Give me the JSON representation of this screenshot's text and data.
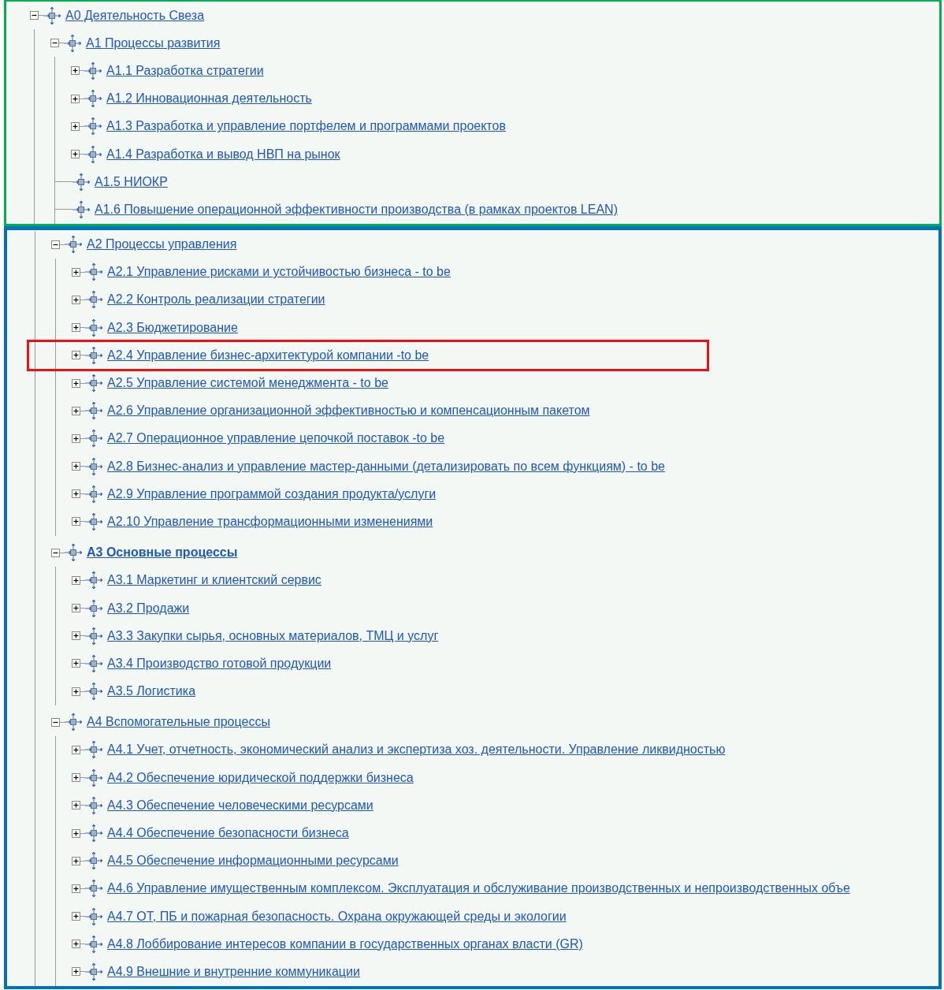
{
  "tree": {
    "root": {
      "label": "A0 Деятельность Свеза",
      "kind": "branch",
      "expanded": true,
      "bold": false,
      "highlighted": false
    },
    "groups": [
      {
        "color": "#00b050",
        "nodes": [
          {
            "label": "A1 Процессы развития",
            "kind": "branch",
            "expanded": true,
            "bold": false,
            "highlighted": false,
            "children": [
              {
                "label": "A1.1 Разработка стратегии",
                "kind": "branch",
                "expanded": false,
                "bold": false,
                "highlighted": false
              },
              {
                "label": "A1.2 Инновационная деятельность",
                "kind": "branch",
                "expanded": false,
                "bold": false,
                "highlighted": false
              },
              {
                "label": "A1.3 Разработка и управление портфелем и программами проектов",
                "kind": "branch",
                "expanded": false,
                "bold": false,
                "highlighted": false
              },
              {
                "label": "A1.4 Разработка и вывод НВП на рынок",
                "kind": "branch",
                "expanded": false,
                "bold": false,
                "highlighted": false
              },
              {
                "label": "A1.5 НИОКР",
                "kind": "leaf",
                "bold": false,
                "highlighted": false
              },
              {
                "label": "A1.6 Повышение операционной эффективности производства (в рамках проектов LEAN)",
                "kind": "leaf",
                "bold": false,
                "highlighted": false
              }
            ]
          }
        ]
      },
      {
        "color": "#0070c0",
        "nodes": [
          {
            "label": "A2 Процессы управления",
            "kind": "branch",
            "expanded": true,
            "bold": false,
            "highlighted": false,
            "children": [
              {
                "label": "A2.1 Управление рисками и устойчивостью бизнеса - to be",
                "kind": "branch",
                "expanded": false,
                "bold": false,
                "highlighted": false
              },
              {
                "label": "A2.2 Контроль реализации стратегии",
                "kind": "branch",
                "expanded": false,
                "bold": false,
                "highlighted": false
              },
              {
                "label": "A2.3 Бюджетирование",
                "kind": "branch",
                "expanded": false,
                "bold": false,
                "highlighted": false
              },
              {
                "label": "A2.4 Управление бизнес-архитектурой компании -to be",
                "kind": "branch",
                "expanded": false,
                "bold": false,
                "highlighted": true
              },
              {
                "label": "A2.5 Управление системой менеджмента - to be",
                "kind": "branch",
                "expanded": false,
                "bold": false,
                "highlighted": false
              },
              {
                "label": "A2.6 Управление организационной эффективностью и компенсационным пакетом",
                "kind": "branch",
                "expanded": false,
                "bold": false,
                "highlighted": false
              },
              {
                "label": "A2.7 Операционное управление цепочкой поставок -to be",
                "kind": "branch",
                "expanded": false,
                "bold": false,
                "highlighted": false
              },
              {
                "label": "A2.8 Бизнес-анализ и управление мастер-данными (детализировать по всем функциям) - to be",
                "kind": "branch",
                "expanded": false,
                "bold": false,
                "highlighted": false
              },
              {
                "label": "A2.9 Управление программой создания продукта/услуги",
                "kind": "branch",
                "expanded": false,
                "bold": false,
                "highlighted": false
              },
              {
                "label": "A2.10 Управление трансформационными изменениями",
                "kind": "branch",
                "expanded": false,
                "bold": false,
                "highlighted": false
              }
            ]
          },
          {
            "label": "A3 Основные процессы",
            "kind": "branch",
            "expanded": true,
            "bold": true,
            "highlighted": false,
            "children": [
              {
                "label": "A3.1 Маркетинг и клиентский сервис",
                "kind": "branch",
                "expanded": false,
                "bold": false,
                "highlighted": false
              },
              {
                "label": "A3.2 Продажи",
                "kind": "branch",
                "expanded": false,
                "bold": false,
                "highlighted": false
              },
              {
                "label": "A3.3 Закупки сырья, основных материалов, ТМЦ и услуг",
                "kind": "branch",
                "expanded": false,
                "bold": false,
                "highlighted": false
              },
              {
                "label": "A3.4 Производство готовой продукции",
                "kind": "branch",
                "expanded": false,
                "bold": false,
                "highlighted": false
              },
              {
                "label": "A3.5 Логистика",
                "kind": "branch",
                "expanded": false,
                "bold": false,
                "highlighted": false
              }
            ]
          },
          {
            "label": "A4 Вспомогательные процессы",
            "kind": "branch",
            "expanded": true,
            "bold": false,
            "highlighted": false,
            "children": [
              {
                "label": "A4.1 Учет, отчетность, экономический анализ и экспертиза хоз. деятельности. Управление ликвидностью",
                "kind": "branch",
                "expanded": false,
                "bold": false,
                "highlighted": false
              },
              {
                "label": "A4.2 Обеспечение юридической поддержки бизнеса",
                "kind": "branch",
                "expanded": false,
                "bold": false,
                "highlighted": false
              },
              {
                "label": "A4.3 Обеспечение человеческими ресурсами",
                "kind": "branch",
                "expanded": false,
                "bold": false,
                "highlighted": false
              },
              {
                "label": "A4.4 Обеспечение безопасности бизнеса",
                "kind": "branch",
                "expanded": false,
                "bold": false,
                "highlighted": false
              },
              {
                "label": "A4.5 Обеспечение информационными ресурсами",
                "kind": "branch",
                "expanded": false,
                "bold": false,
                "highlighted": false
              },
              {
                "label": "A4.6 Управление имущественным комплексом. Эксплуатация и обслуживание производственных и непроизводственных объе",
                "kind": "branch",
                "expanded": false,
                "bold": false,
                "highlighted": false
              },
              {
                "label": "A4.7 ОТ, ПБ и пожарная безопасность. Охрана окружающей среды и экологии",
                "kind": "branch",
                "expanded": false,
                "bold": false,
                "highlighted": false
              },
              {
                "label": "A4.8 Лоббирование интересов компании в государственных органах власти (GR)",
                "kind": "branch",
                "expanded": false,
                "bold": false,
                "highlighted": false
              },
              {
                "label": "A4.9 Внешние и внутренние коммуникации",
                "kind": "branch",
                "expanded": false,
                "bold": false,
                "highlighted": false
              }
            ]
          }
        ]
      }
    ]
  }
}
